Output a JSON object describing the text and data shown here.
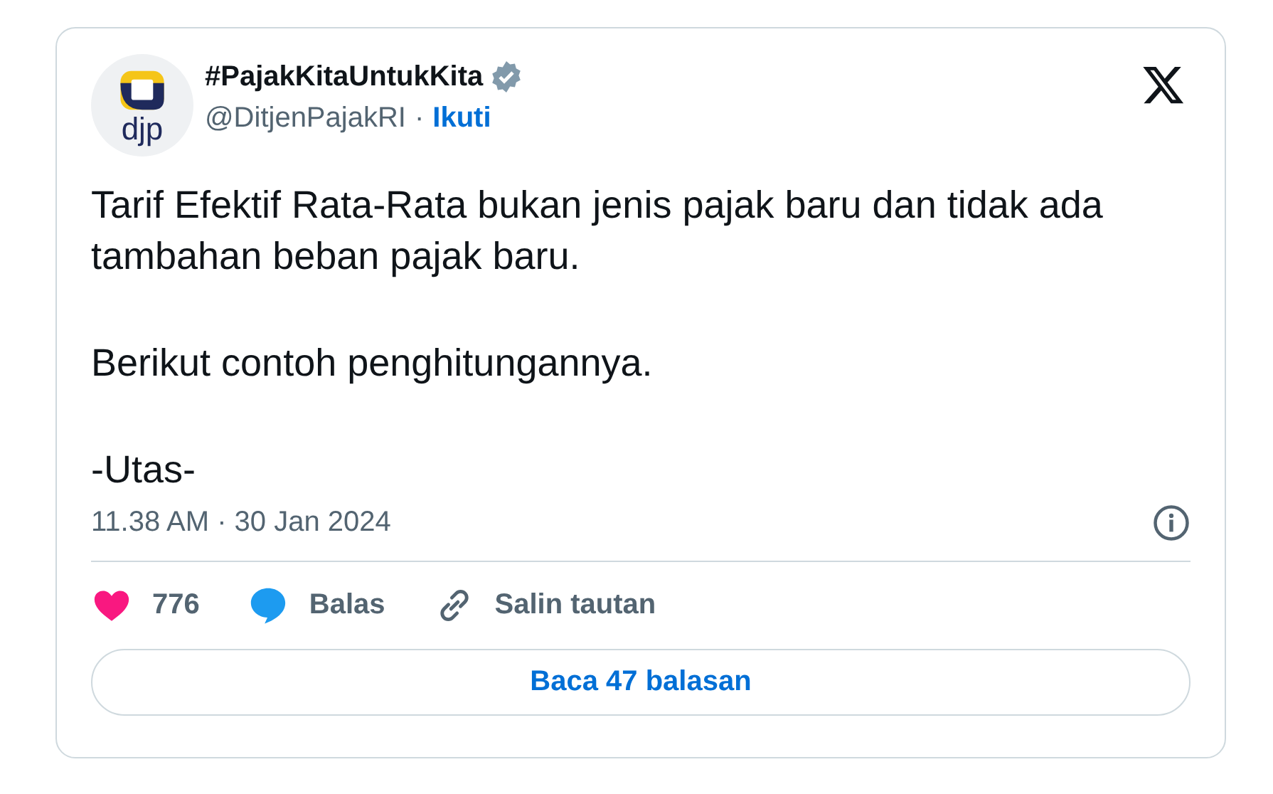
{
  "author": {
    "avatar_text": "djp",
    "name": "#PajakKitaUntukKita",
    "verified": true,
    "handle": "@DitjenPajakRI",
    "separator": "·",
    "follow": "Ikuti"
  },
  "paragraphs": [
    "Tarif Efektif Rata-Rata bukan jenis pajak baru dan tidak ada tambahan beban pajak baru.",
    "Berikut contoh penghitungannya.",
    "-Utas-"
  ],
  "timestamp": "11.38 AM · 30 Jan 2024",
  "actions": [
    {
      "kind": "like",
      "label": "776"
    },
    {
      "kind": "reply",
      "label": "Balas"
    },
    {
      "kind": "copy-link",
      "label": "Salin tautan"
    }
  ],
  "read_replies": "Baca 47 balasan"
}
